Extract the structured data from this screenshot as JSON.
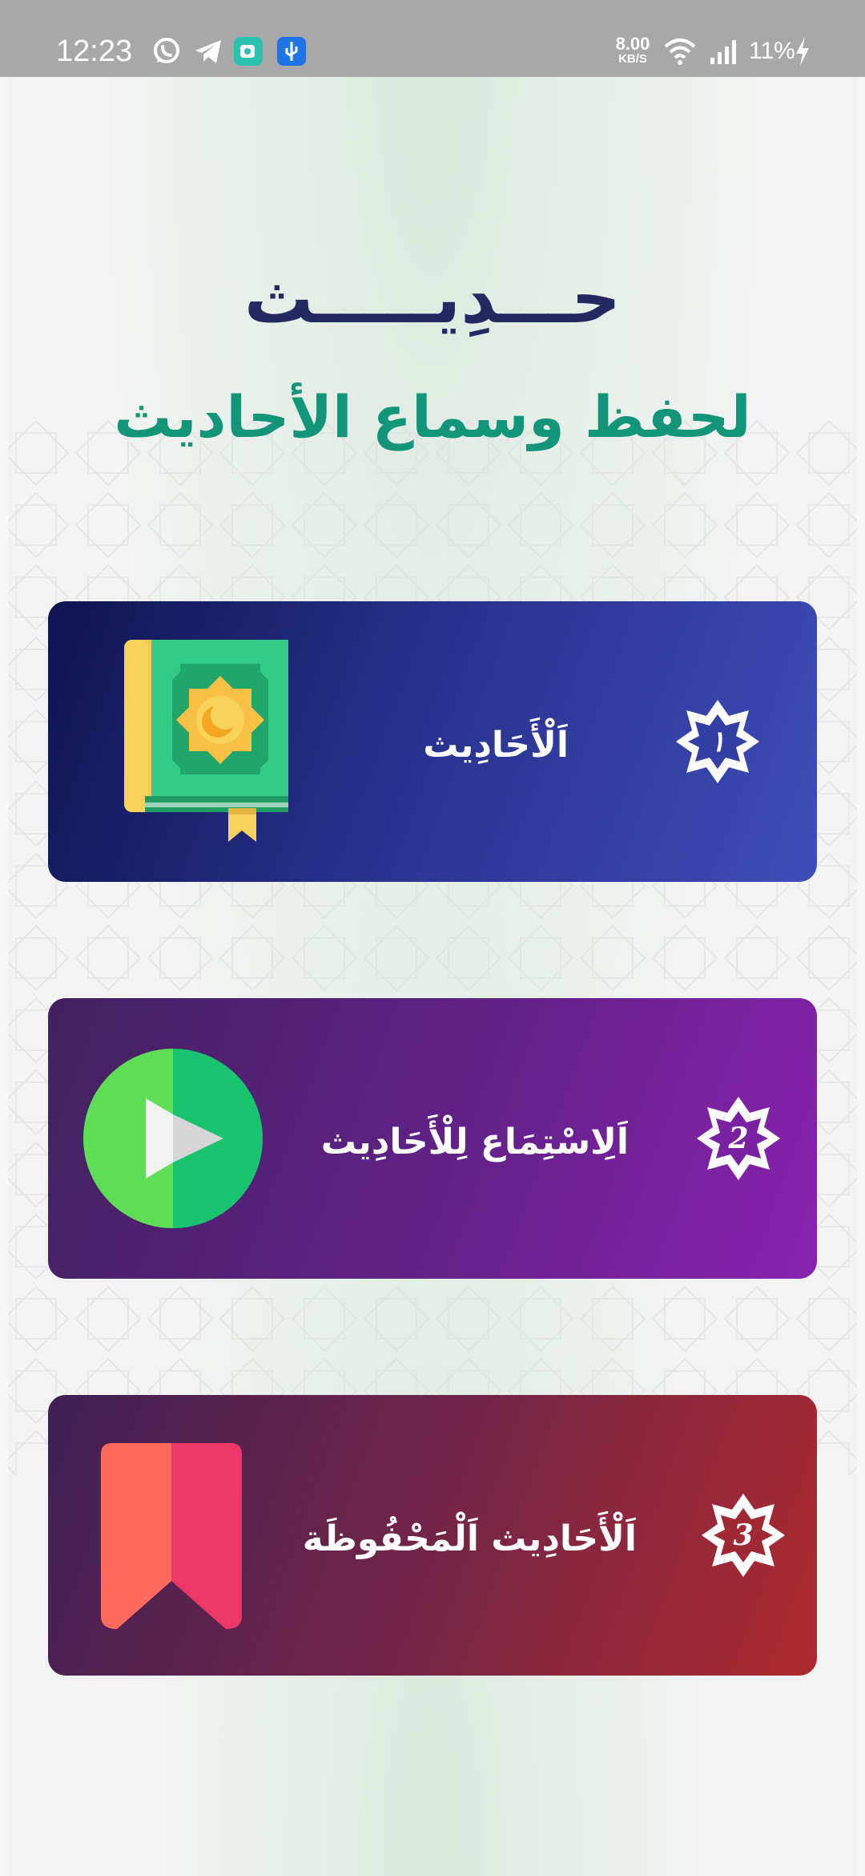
{
  "status_bar": {
    "time": "12:23",
    "net_speed_value": "8.00",
    "net_speed_unit": "KB/S",
    "battery": "11%",
    "icons": [
      "whatsapp-icon",
      "telegram-icon",
      "app-notification-icon",
      "usb-icon",
      "wifi-icon",
      "signal-icon",
      "charging-icon"
    ]
  },
  "header": {
    "title": "حـــدِيـــــث",
    "subtitle": "لحفظ وسماع الأحاديث"
  },
  "menu": [
    {
      "number": "١",
      "label": "اَلْأَحَادِيث",
      "icon": "book-icon"
    },
    {
      "number": "2",
      "label": "اَلِاسْتِمَاع لِلْأَحَادِيث",
      "icon": "play-icon"
    },
    {
      "number": "3",
      "label": "اَلْأَحَادِيث اَلْمَحْفُوظَة",
      "icon": "bookmark-icon"
    }
  ],
  "colors": {
    "title": "#232a62",
    "subtitle": "#13957a",
    "card1": [
      "#0f1550",
      "#3e4db8"
    ],
    "card2": [
      "#42215e",
      "#8a22ae"
    ],
    "card3": [
      "#3f1f55",
      "#ae2a2e"
    ]
  }
}
